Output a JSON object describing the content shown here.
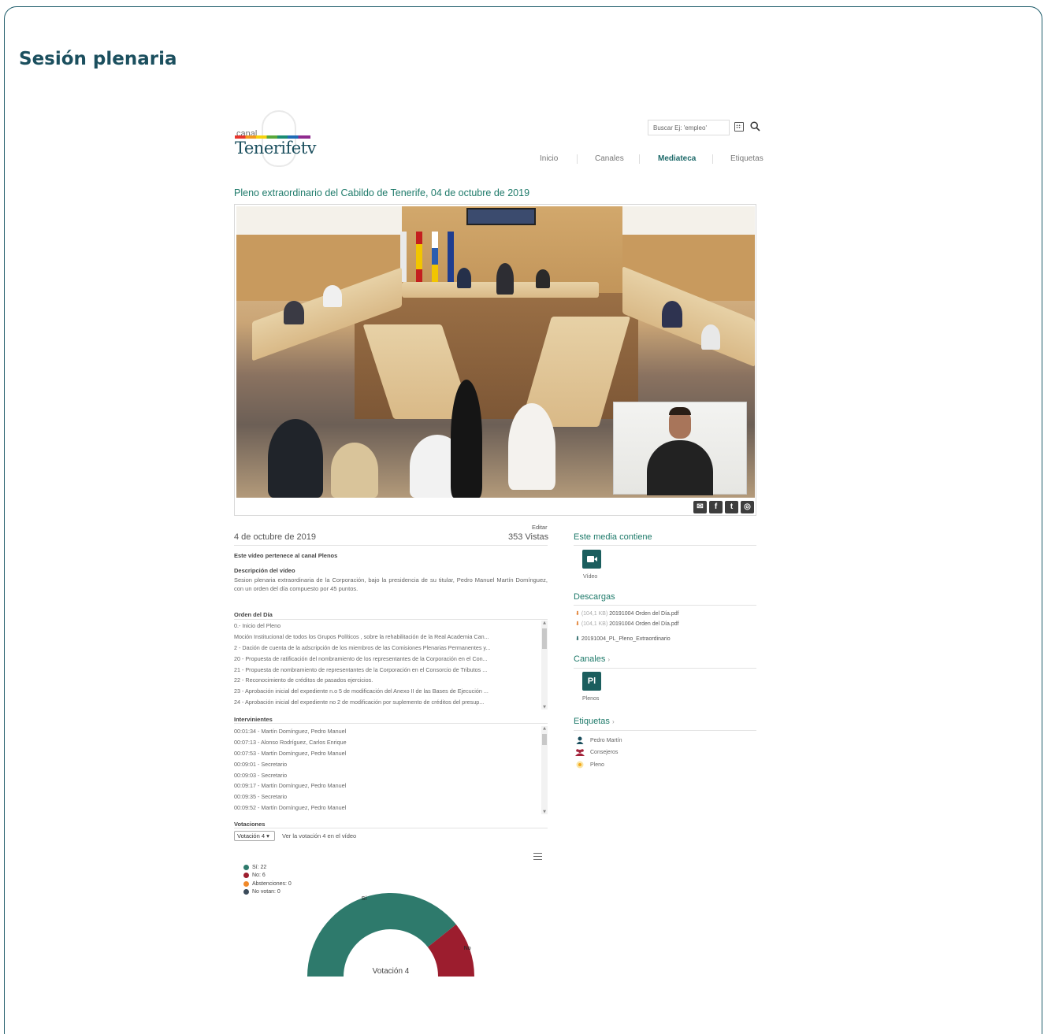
{
  "page": {
    "title": "Sesión plenaria"
  },
  "header": {
    "logo_small": "canal",
    "logo_name": "Tenerifetv",
    "search_placeholder": "Buscar Ej: 'empleo'",
    "nav": [
      "Inicio",
      "Canales",
      "Mediateca",
      "Etiquetas"
    ],
    "nav_active": "Mediateca"
  },
  "video": {
    "title": "Pleno extraordinario del Cabildo de Tenerife, 04 de octubre de 2019",
    "share_icons": [
      "email-icon",
      "facebook-icon",
      "twitter-icon",
      "whatsapp-icon"
    ]
  },
  "info": {
    "edit": "Editar",
    "date": "4 de octubre de 2019",
    "views": "353 Vistas",
    "channel_note": "Este vídeo pertenece al canal Plenos",
    "description_label": "Descripción del vídeo",
    "description": "Sesion plenaria extraordinaria de la Corporación, bajo la presidencia de su titular, Pedro Manuel Martín Domínguez, con un orden del día compuesto por 45 puntos."
  },
  "agenda": {
    "label": "Orden del Día",
    "items": [
      "0.- Inicio del Pleno",
      "Moción Institucional de todos los Grupos Políticos , sobre la rehabilitación de la Real Academia Can...",
      "2 - Dación de cuenta de la adscripción de los miembros de las Comisiones Plenarias Permanentes y...",
      "20 - Propuesta de ratificación del nombramiento de los representantes de la Corporación en el Con...",
      "21 - Propuesta de nombramiento de representantes de la Corporación en el Consorcio de Tributos ...",
      "22 - Reconocimiento de créditos de pasados ejercicios.",
      "23 - Aprobación inicial del expediente n.o 5 de modificación del Anexo II de las Bases de Ejecución ...",
      "24 - Aprobación inicial del expediente no 2 de modificación por suplemento de créditos del presup..."
    ]
  },
  "speakers": {
    "label": "Intervinientes",
    "items": [
      "00:01:34 - Martín Domínguez, Pedro Manuel",
      "00:07:13 - Alonso Rodríguez, Carlos Enrique",
      "00:07:53 - Martín Domínguez, Pedro Manuel",
      "00:09:01 - Secretario",
      "00:09:03 - Secretario",
      "00:09:17 - Martín Domínguez, Pedro Manuel",
      "00:09:35 - Secretario",
      "00:09:52 - Martín Domínguez, Pedro Manuel"
    ]
  },
  "votes": {
    "label": "Votaciones",
    "selected": "Votación 4 ▾",
    "link": "Ver la votación 4 en el vídeo"
  },
  "chart_data": {
    "type": "pie",
    "title": "Votación 4",
    "categories": [
      "Sí",
      "No",
      "Abstenciones",
      "No votan"
    ],
    "values": [
      22,
      6,
      0,
      0
    ],
    "legend": [
      "Sí: 22",
      "No: 6",
      "Abstenciones: 0",
      "No votan: 0"
    ],
    "slice_labels": [
      "Sí",
      "No"
    ],
    "colors": [
      "#2e7a6c",
      "#9c1d2e",
      "#f0892a",
      "#3b4b5a"
    ],
    "legend_placement": "top-left",
    "semicircle": true
  },
  "sidebar": {
    "contains_heading": "Este media contiene",
    "contains_tile": "Vídeo",
    "downloads_heading": "Descargas",
    "downloads": [
      {
        "size": "(104,1 KB)",
        "name": "20191004 Orden del Día.pdf"
      },
      {
        "size": "(104,1 KB)",
        "name": "20191004 Orden del Día.pdf"
      },
      {
        "size": "",
        "name": "20191004_PL_Pleno_Extraordinario"
      }
    ],
    "channels_heading": "Canales",
    "channel_tile": "Pl",
    "channel_caption": "Plenos",
    "tags_heading": "Etiquetas",
    "tags": [
      "Pedro Martín",
      "Consejeros",
      "Pleno"
    ]
  },
  "colors": {
    "accent": "#1e7a6a",
    "title": "#1b4f5e",
    "tile": "#1b5e5e"
  }
}
